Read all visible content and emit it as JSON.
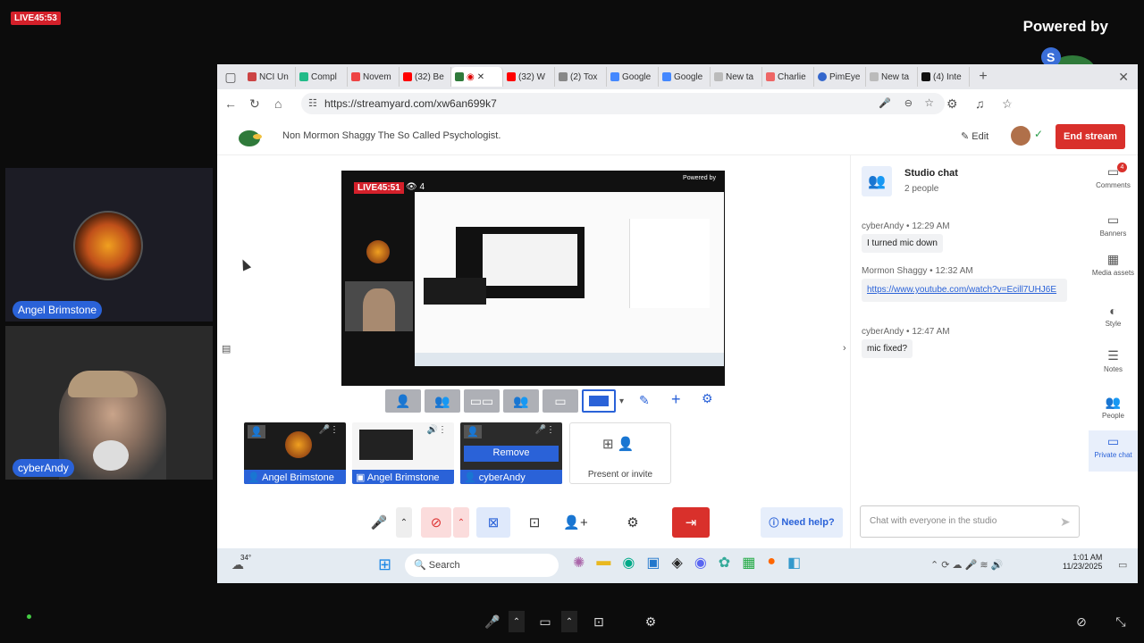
{
  "live_badge": "LIVE45:53",
  "powered_by": "Powered by",
  "brand_watermark": "StreamYard",
  "cameras": [
    {
      "name": "Angel Brimstone"
    },
    {
      "name": "cyberAndy"
    }
  ],
  "browser": {
    "tabs": [
      "NCI Un",
      "Compl",
      "Novem",
      "(32) Be",
      "",
      "(32) W",
      "(2) Tox",
      "Google",
      "Google",
      "New ta",
      "Charlie",
      "PimEye",
      "New ta",
      "(4) Inte"
    ],
    "url": "https://streamyard.com/xw6an699k7"
  },
  "streamyard": {
    "title": "Non Mormon Shaggy The So Called Psychologist.",
    "edit_label": "Edit",
    "end_stream_label": "End stream",
    "stage": {
      "live": "LIVE45:51",
      "viewers": "4"
    },
    "tiles": [
      {
        "name": "Angel Brimstone"
      },
      {
        "name": "Angel Brimstone"
      },
      {
        "name": "cyberAndy",
        "overlay": "Remove"
      }
    ],
    "present_label": "Present or invite",
    "help_label": "Need help?",
    "chat": {
      "title": "Studio chat",
      "subtitle": "2 people",
      "messages": [
        {
          "author": "cyberAndy",
          "time": "12:29 AM",
          "text": "I turned mic down"
        },
        {
          "author": "Mormon Shaggy",
          "time": "12:32 AM",
          "text": "https://www.youtube.com/watch?v=Ecill7UHJ6E"
        },
        {
          "author": "cyberAndy",
          "time": "12:47 AM",
          "text": "mic fixed?"
        }
      ],
      "input_placeholder": "Chat with everyone in the studio"
    },
    "right_nav": [
      {
        "label": "Comments",
        "icon": "comment-icon",
        "badge": "4"
      },
      {
        "label": "Banners",
        "icon": "banner-icon"
      },
      {
        "label": "Media assets",
        "icon": "media-icon"
      },
      {
        "label": "Style",
        "icon": "palette-icon"
      },
      {
        "label": "Notes",
        "icon": "notes-icon"
      },
      {
        "label": "People",
        "icon": "people-icon"
      },
      {
        "label": "Private chat",
        "icon": "private-chat-icon"
      }
    ]
  },
  "taskbar": {
    "weather": "34°",
    "search": "Search",
    "time": "1:01 AM",
    "date": "11/23/2025"
  },
  "colors": {
    "accent": "#2a62d8",
    "danger": "#d9302b",
    "live": "#d4202a"
  }
}
